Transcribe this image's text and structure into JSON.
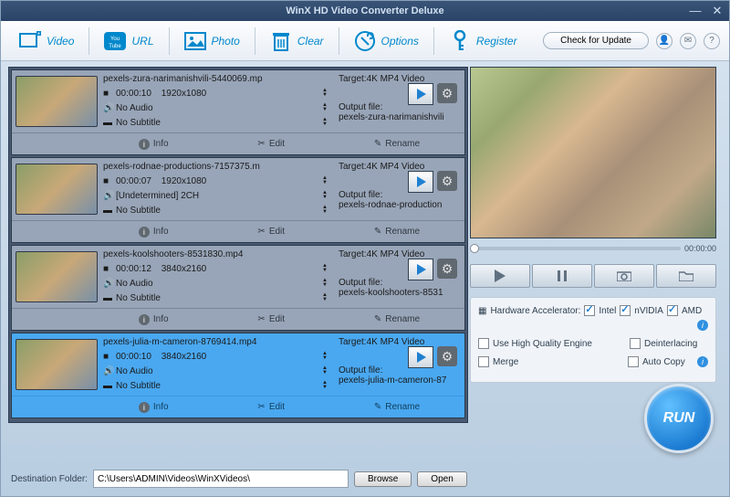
{
  "app_title": "WinX HD Video Converter Deluxe",
  "toolbar": {
    "video": "Video",
    "url": "URL",
    "photo": "Photo",
    "clear": "Clear",
    "options": "Options",
    "register": "Register",
    "update": "Check for Update"
  },
  "items": [
    {
      "filename": "pexels-zura-narimanishvili-5440069.mp",
      "duration": "00:00:10",
      "resolution": "1920x1080",
      "audio": "No Audio",
      "subtitle": "No Subtitle",
      "target": "Target:4K MP4 Video",
      "output_label": "Output file:",
      "output_file": "pexels-zura-narimanishvili"
    },
    {
      "filename": "pexels-rodnae-productions-7157375.m",
      "duration": "00:00:07",
      "resolution": "1920x1080",
      "audio": "[Undetermined] 2CH",
      "subtitle": "No Subtitle",
      "target": "Target:4K MP4 Video",
      "output_label": "Output file:",
      "output_file": "pexels-rodnae-production"
    },
    {
      "filename": "pexels-koolshooters-8531830.mp4",
      "duration": "00:00:12",
      "resolution": "3840x2160",
      "audio": "No Audio",
      "subtitle": "No Subtitle",
      "target": "Target:4K MP4 Video",
      "output_label": "Output file:",
      "output_file": "pexels-koolshooters-8531"
    },
    {
      "filename": "pexels-julia-m-cameron-8769414.mp4",
      "duration": "00:00:10",
      "resolution": "3840x2160",
      "audio": "No Audio",
      "subtitle": "No Subtitle",
      "target": "Target:4K MP4 Video",
      "output_label": "Output file:",
      "output_file": "pexels-julia-m-cameron-87"
    }
  ],
  "actions": {
    "info": "Info",
    "edit": "Edit",
    "rename": "Rename"
  },
  "timeline": {
    "time": "00:00:00"
  },
  "opts": {
    "hw_label": "Hardware Accelerator:",
    "intel": "Intel",
    "nvidia": "nVIDIA",
    "amd": "AMD",
    "hq": "Use High Quality Engine",
    "deint": "Deinterlacing",
    "merge": "Merge",
    "autocopy": "Auto Copy"
  },
  "run": "RUN",
  "footer": {
    "dest_label": "Destination Folder:",
    "dest_path": "C:\\Users\\ADMIN\\Videos\\WinXVideos\\",
    "browse": "Browse",
    "open": "Open"
  }
}
